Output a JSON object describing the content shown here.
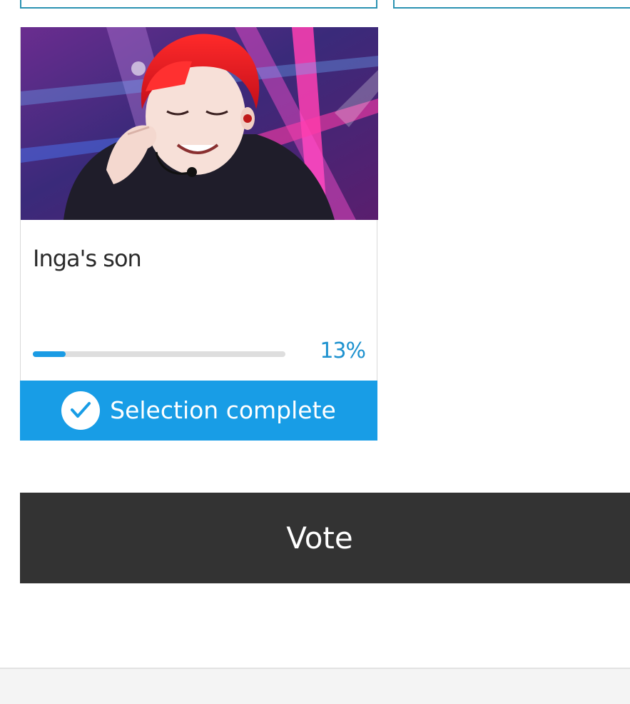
{
  "candidate": {
    "name": "Inga's son",
    "vote_share_percent": 13,
    "percent_label": "13%",
    "status_label": "Selection complete",
    "photo_description_icon": "candidate-photo"
  },
  "actions": {
    "vote_label": "Vote"
  },
  "colors": {
    "accent": "#189de6",
    "percent_text": "#1e92cf",
    "vote_button_bg": "#333333",
    "card_border_prev": "#2b93b2"
  }
}
